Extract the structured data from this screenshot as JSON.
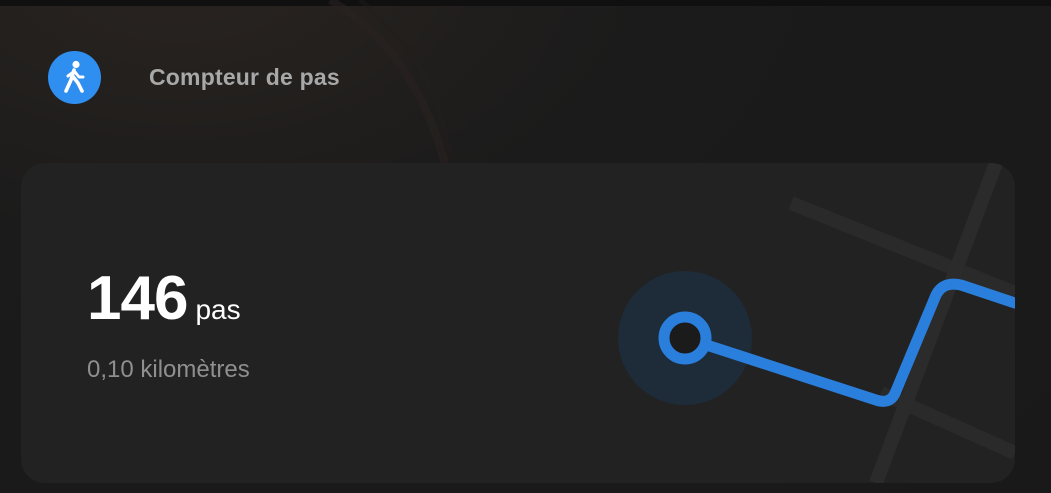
{
  "header": {
    "title": "Compteur de pas",
    "icon": "walking-person-icon"
  },
  "card": {
    "steps_value": "146",
    "steps_unit": "pas",
    "distance": "0,10 kilomètres",
    "map_icon": "route-map-illustration"
  },
  "colors": {
    "accent": "#2f8ff0",
    "route": "#2b7fdc",
    "background": "#1b1b1b",
    "card": "#222222"
  }
}
